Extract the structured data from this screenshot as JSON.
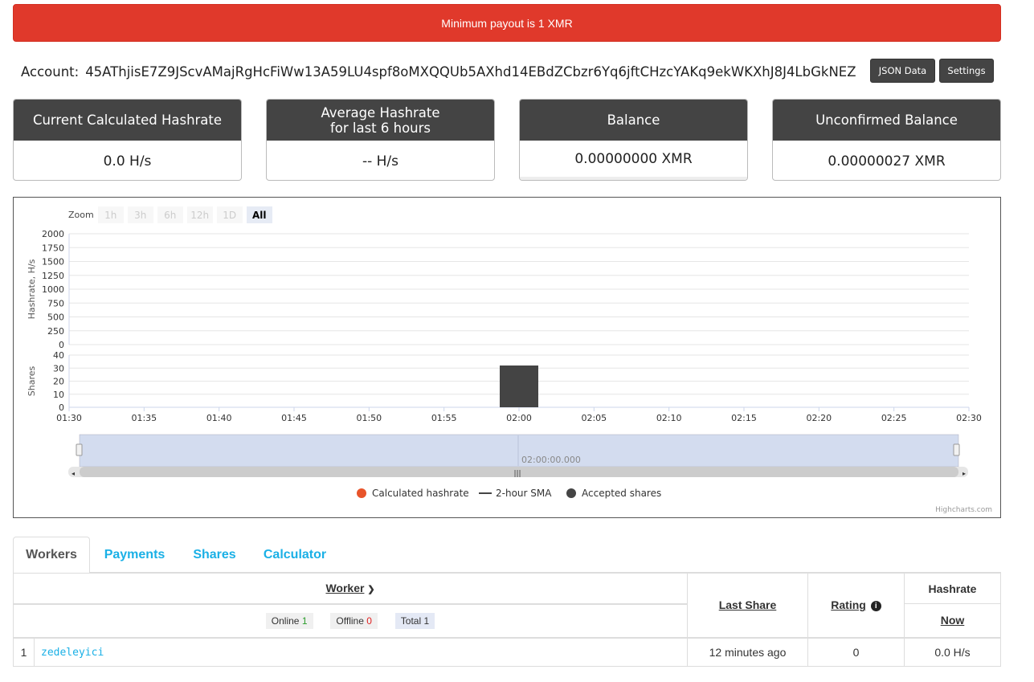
{
  "alert": {
    "text": "Minimum payout is 1 XMR"
  },
  "account": {
    "label": "Account:",
    "address": "45AThjisE7Z9JScvAMajRgHcFiWw13A59LU4spf8oMXQQUb5AXhd14EBdZCbzr6Yq6jftCHzcYAKq9ekWKXhJ8J4LbGkNEZ",
    "json_button": "JSON Data",
    "settings_button": "Settings"
  },
  "stats": [
    {
      "title_line1": "Current Calculated Hashrate",
      "title_line2": "",
      "value": "0.0 H/s"
    },
    {
      "title_line1": "Average Hashrate",
      "title_line2": "for last 6 hours",
      "value": "-- H/s"
    },
    {
      "title_line1": "Balance",
      "title_line2": "",
      "value": "0.00000000 XMR"
    },
    {
      "title_line1": "Unconfirmed Balance",
      "title_line2": "",
      "value": "0.00000027 XMR"
    }
  ],
  "zoom": {
    "label": "Zoom",
    "buttons": [
      "1h",
      "3h",
      "6h",
      "12h",
      "1D",
      "All"
    ],
    "active": "All"
  },
  "chart_data": {
    "type": "bar",
    "panes": [
      {
        "ylabel": "Hashrate, H/s",
        "ylim": [
          0,
          2000
        ],
        "yticks": [
          0,
          250,
          500,
          750,
          1000,
          1250,
          1500,
          1750,
          2000
        ]
      },
      {
        "ylabel": "Shares",
        "ylim": [
          0,
          40
        ],
        "yticks": [
          0,
          10,
          20,
          30,
          40
        ]
      }
    ],
    "x_ticks": [
      "01:30",
      "01:35",
      "01:40",
      "01:45",
      "01:50",
      "01:55",
      "02:00",
      "02:05",
      "02:10",
      "02:15",
      "02:20",
      "02:25",
      "02:30"
    ],
    "series": [
      {
        "name": "Calculated hashrate",
        "color": "#e8542a",
        "values": []
      },
      {
        "name": "2-hour SMA",
        "color": "#444444",
        "values": []
      },
      {
        "name": "Accepted shares",
        "color": "#444444",
        "x": [
          "02:00"
        ],
        "values": [
          32
        ]
      }
    ],
    "navigator_label": "02:00:00.000",
    "credit": "Highcharts.com"
  },
  "tabs": [
    "Workers",
    "Payments",
    "Shares",
    "Calculator"
  ],
  "workers_table": {
    "worker_header": "Worker",
    "last_share_header": "Last Share",
    "rating_header": "Rating",
    "hashrate_header": "Hashrate",
    "now_header": "Now",
    "online_label": "Online",
    "online_count": "1",
    "offline_label": "Offline",
    "offline_count": "0",
    "total_label": "Total",
    "total_count": "1",
    "rows": [
      {
        "index": "1",
        "name": "zedeleyici",
        "last_share": "12 minutes ago",
        "rating": "0",
        "hashrate": "0.0 H/s"
      }
    ]
  }
}
